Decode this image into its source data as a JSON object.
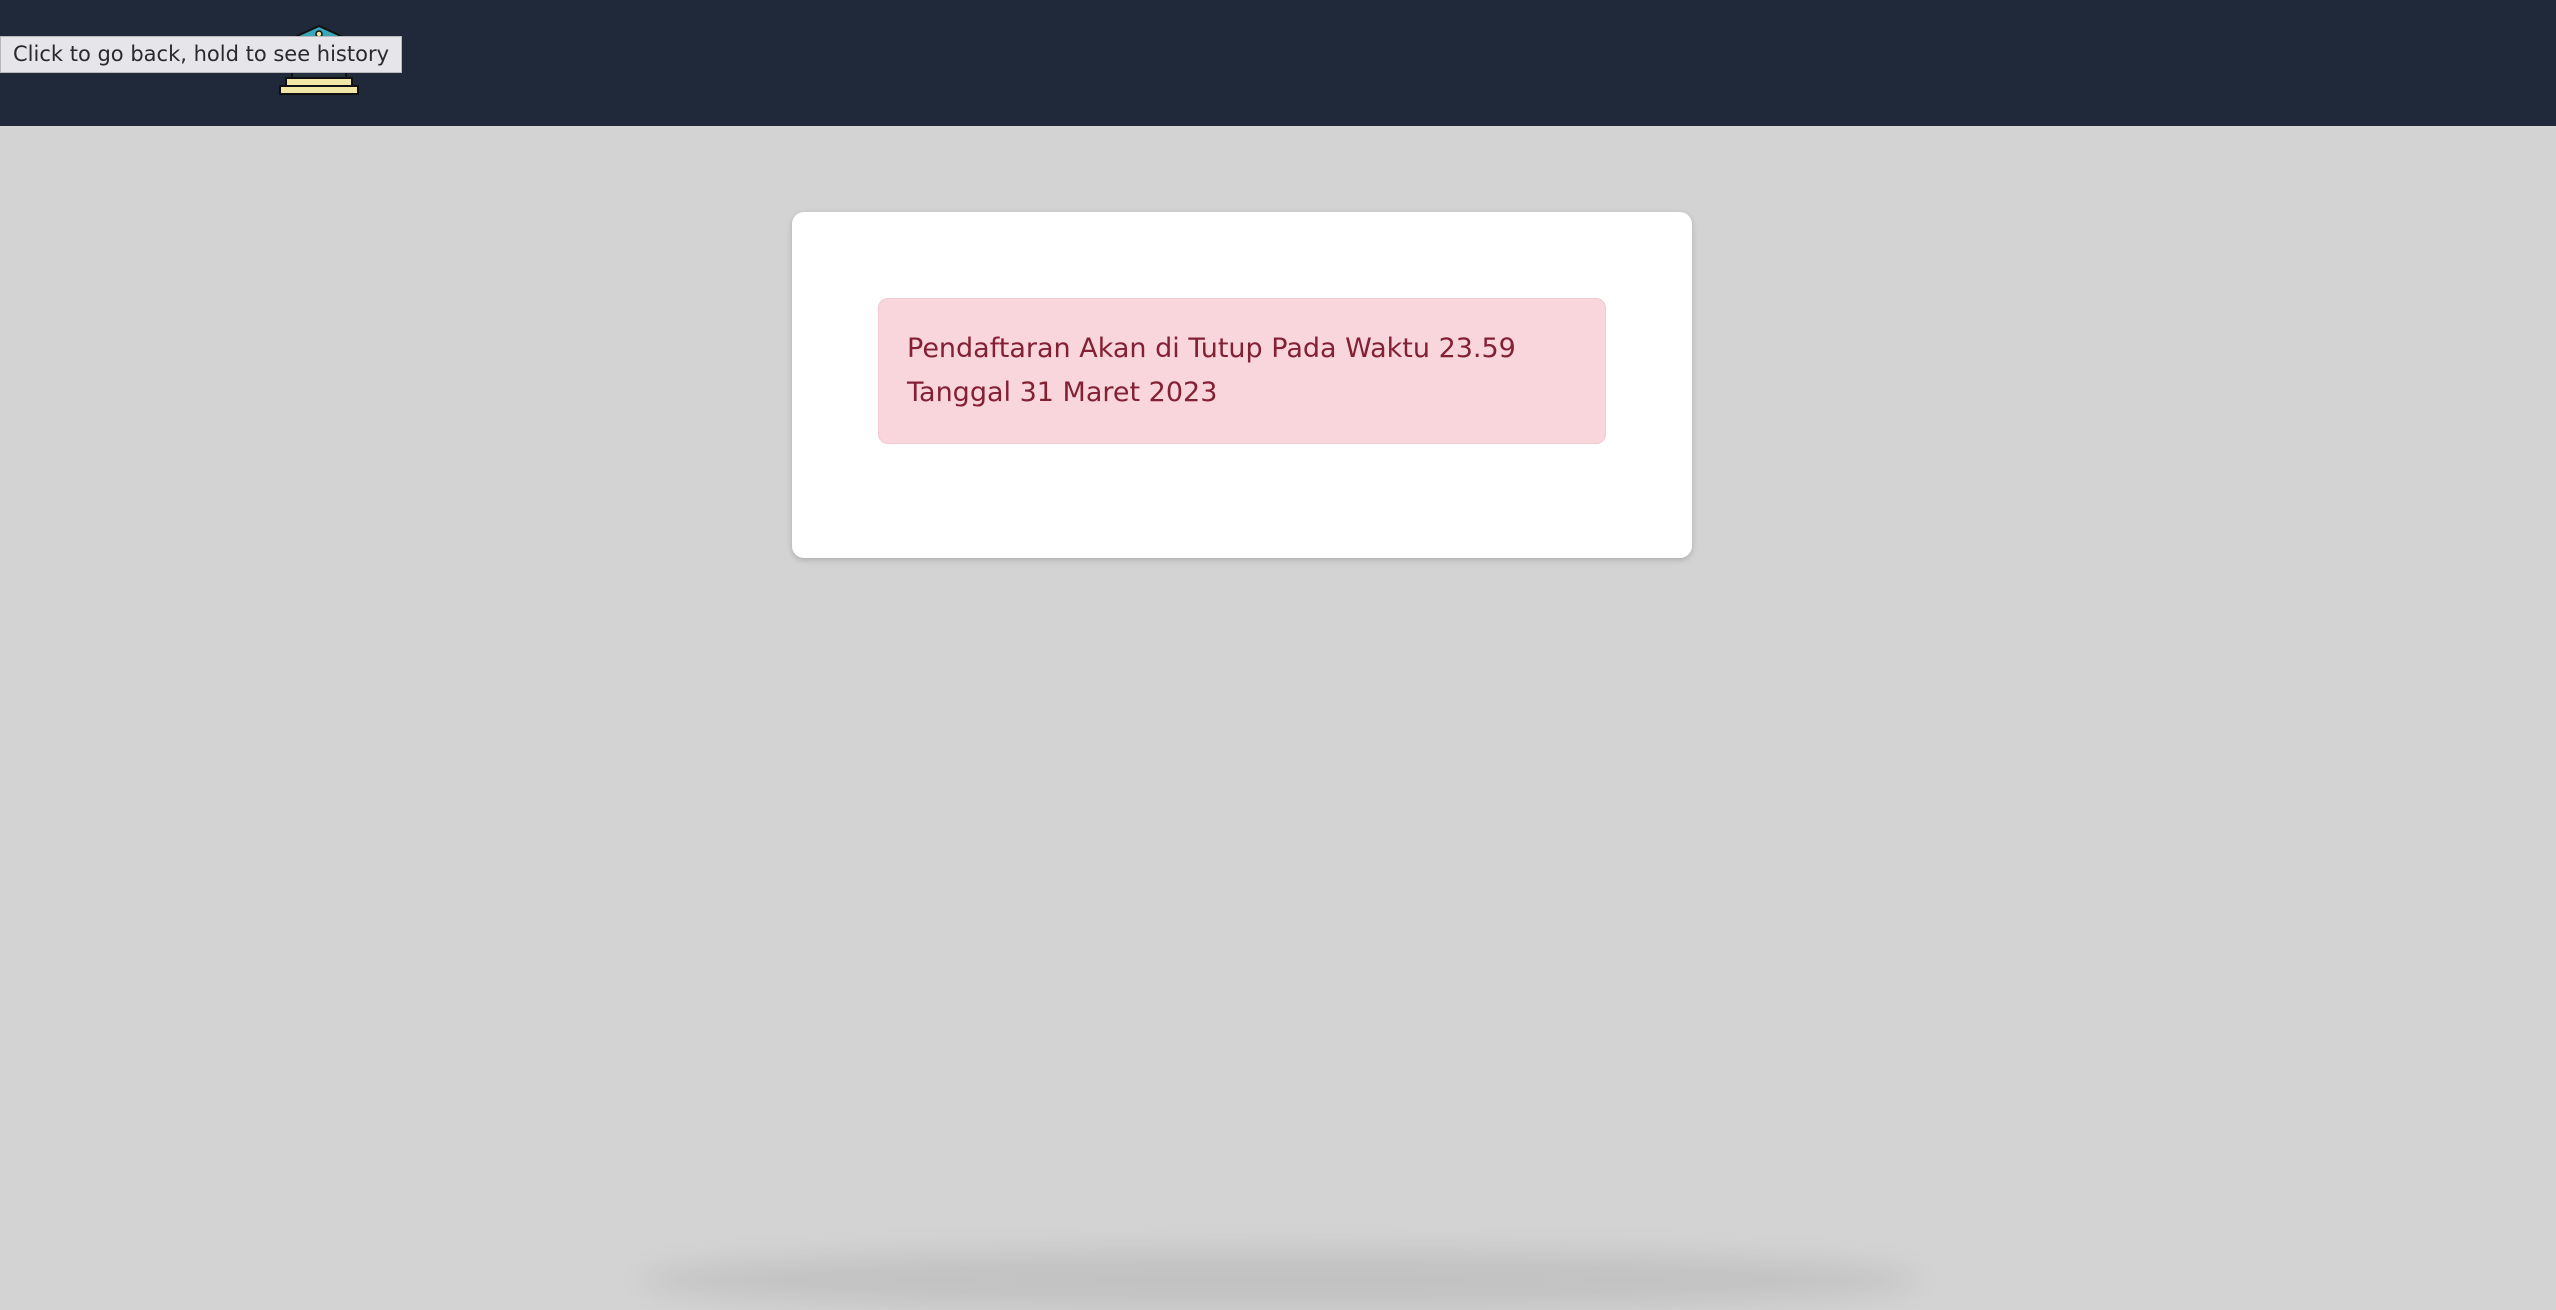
{
  "tooltip": {
    "text": "Click to go back, hold to see history"
  },
  "navbar": {
    "logo_icon": "school-building-icon"
  },
  "alert": {
    "message": "Pendaftaran Akan di Tutup Pada Waktu 23.59 Tanggal 31 Maret 2023"
  },
  "colors": {
    "navbar_bg": "#1f2939",
    "page_bg": "#d3d3d3",
    "alert_bg": "#f8d6dc",
    "alert_text": "#842033"
  }
}
